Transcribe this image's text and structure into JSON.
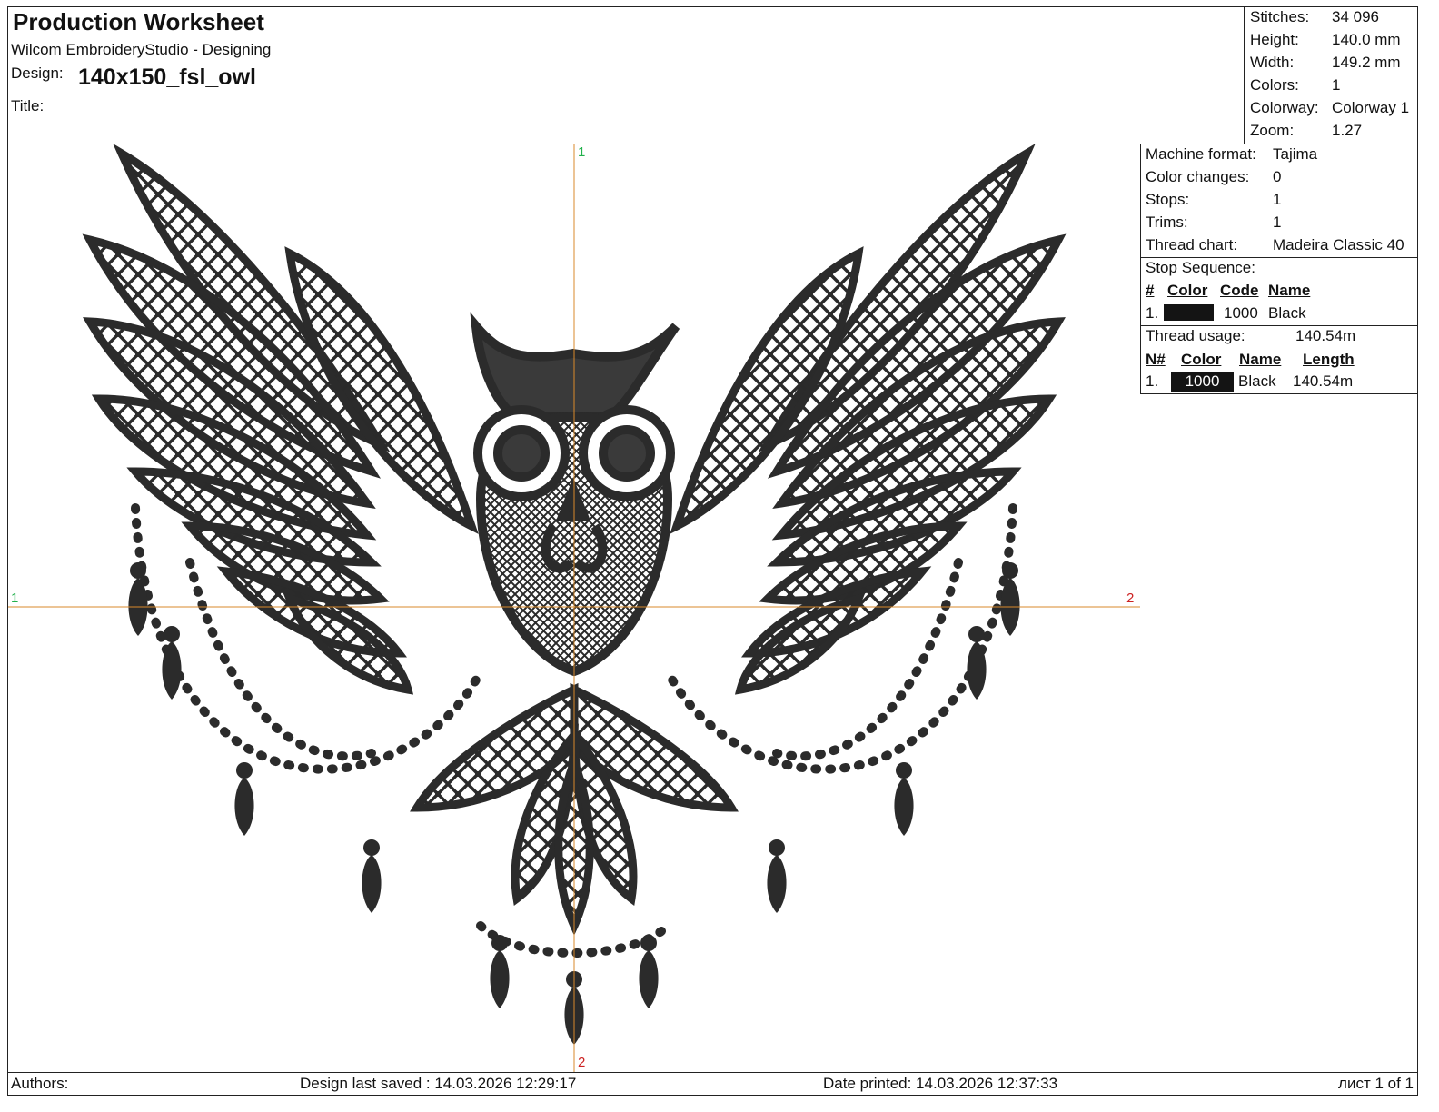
{
  "header": {
    "title": "Production Worksheet",
    "software": "Wilcom EmbroideryStudio - Designing",
    "design_label": "Design:",
    "design_name": "140x150_fsl_owl",
    "title_label": "Title:"
  },
  "stats": [
    {
      "label": "Stitches:",
      "value": "34 096"
    },
    {
      "label": "Height:",
      "value": "140.0 mm"
    },
    {
      "label": "Width:",
      "value": "149.2 mm"
    },
    {
      "label": "Colors:",
      "value": "1"
    },
    {
      "label": "Colorway:",
      "value": "Colorway 1"
    },
    {
      "label": "Zoom:",
      "value": "1.27"
    }
  ],
  "machine": [
    {
      "label": "Machine format:",
      "value": "Tajima"
    },
    {
      "label": "Color changes:",
      "value": "0"
    },
    {
      "label": "Stops:",
      "value": "1"
    },
    {
      "label": "Trims:",
      "value": "1"
    },
    {
      "label": "Thread chart:",
      "value": "Madeira Classic 40"
    }
  ],
  "stop_sequence": {
    "title": "Stop Sequence:",
    "headers": [
      "#",
      "Color",
      "Code",
      "Name"
    ],
    "rows": [
      {
        "num": "1.",
        "color": "#141414",
        "code": "1000",
        "name": "Black"
      }
    ]
  },
  "thread_usage": {
    "label": "Thread usage:",
    "value": "140.54m",
    "headers": [
      "N#",
      "Color",
      "Name",
      "Length"
    ],
    "rows": [
      {
        "num": "1.",
        "color": "#141414",
        "code": "1000",
        "name": "Black",
        "length": "140.54m"
      }
    ]
  },
  "axes": {
    "top": "1",
    "left": "1",
    "right": "2",
    "bottom": "2"
  },
  "colors": {
    "thread": "#141414",
    "axis_line": "#d98a2b",
    "axis_label_start": "#22b14c",
    "axis_label_end": "#cc2222"
  },
  "footer": {
    "authors": "Authors:",
    "last_saved": "Design last saved : 14.03.2026 12:29:17",
    "printed": "Date printed: 14.03.2026 12:37:33",
    "page": "лист 1 of 1"
  }
}
